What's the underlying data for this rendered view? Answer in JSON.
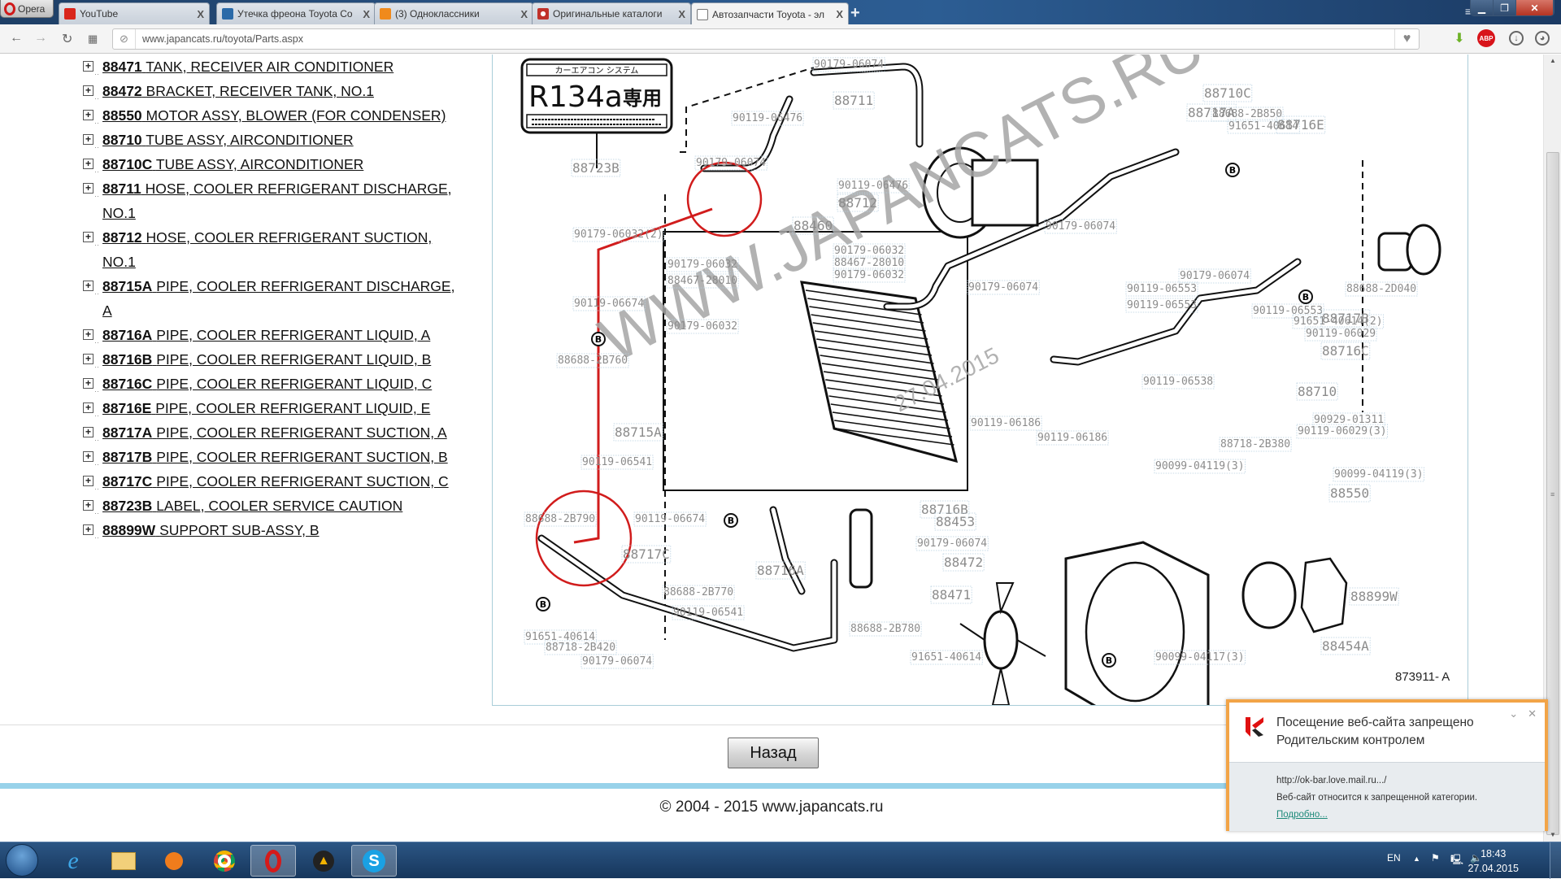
{
  "browser": {
    "menu_label": "Opera",
    "tabs": [
      {
        "label": "YouTube",
        "icon": "youtube-icon",
        "active": false
      },
      {
        "label": "Утечка фреона Toyota Co",
        "icon": "site-v-icon",
        "active": false
      },
      {
        "label": "(3) Одноклассники",
        "icon": "odnoklassniki-icon",
        "active": false
      },
      {
        "label": "Оригинальные каталоги",
        "icon": "catalog-site-icon",
        "active": false
      },
      {
        "label": "Автозапчасти Toyota - эл",
        "icon": "page-icon",
        "active": true
      }
    ],
    "new_tab": "+",
    "close_glyph": "X",
    "url": "www.japancats.ru/toyota/Parts.aspx",
    "extensions": [
      "heart-icon",
      "download-arrow-icon",
      "adblock-icon",
      "downloads-icon",
      "account-icon"
    ],
    "adblock_label": "ABP"
  },
  "parts": [
    {
      "code": "88471",
      "name": "TANK, RECEIVER AIR CONDITIONER"
    },
    {
      "code": "88472",
      "name": "BRACKET, RECEIVER TANK, NO.1"
    },
    {
      "code": "88550",
      "name": "MOTOR ASSY, BLOWER (FOR CONDENSER)"
    },
    {
      "code": "88710",
      "name": "TUBE ASSY, AIRCONDITIONER"
    },
    {
      "code": "88710C",
      "name": "TUBE ASSY, AIRCONDITIONER"
    },
    {
      "code": "88711",
      "name": "HOSE, COOLER REFRIGERANT DISCHARGE, NO.1"
    },
    {
      "code": "88712",
      "name": "HOSE, COOLER REFRIGERANT SUCTION, NO.1"
    },
    {
      "code": "88715A",
      "name": "PIPE, COOLER REFRIGERANT DISCHARGE, A"
    },
    {
      "code": "88716A",
      "name": "PIPE, COOLER REFRIGERANT LIQUID, A"
    },
    {
      "code": "88716B",
      "name": "PIPE, COOLER REFRIGERANT LIQUID, B"
    },
    {
      "code": "88716C",
      "name": "PIPE, COOLER REFRIGERANT LIQUID, C"
    },
    {
      "code": "88716E",
      "name": "PIPE, COOLER REFRIGERANT LIQUID, E"
    },
    {
      "code": "88717A",
      "name": "PIPE, COOLER REFRIGERANT SUCTION, A"
    },
    {
      "code": "88717B",
      "name": "PIPE, COOLER REFRIGERANT SUCTION, B"
    },
    {
      "code": "88717C",
      "name": "PIPE, COOLER REFRIGERANT SUCTION, C"
    },
    {
      "code": "88723B",
      "name": "LABEL, COOLER SERVICE CAUTION"
    },
    {
      "code": "88899W",
      "name": "SUPPORT SUB-ASSY, B"
    }
  ],
  "diagram": {
    "label_plate": {
      "header": "カーエアコン システム",
      "refrigerant": "R134a",
      "kanji": "専用"
    },
    "watermark": "WWW.JAPANCATS.RU",
    "watermark_date": "27.04.2015",
    "figure_id": "873911- A",
    "callouts": [
      "90179-06074",
      "88711",
      "90119-06476",
      "90119-06476",
      "88723B",
      "90179-06074",
      "88712",
      "88460",
      "90179-06032(2)",
      "90179-06032",
      "88467-28010",
      "90179-06032",
      "90179-06032",
      "88467-28010",
      "90179-06032",
      "90119-06674",
      "88688-2B760",
      "88715A",
      "90119-06541",
      "88688-2B790",
      "90119-06674",
      "88717C",
      "88716A",
      "88688-2B770",
      "90119-06541",
      "91651-40614",
      "88718-2B420",
      "90179-06074",
      "88710C",
      "88717A",
      "88688-2B850",
      "91651-40614",
      "88716E",
      "90179-06074",
      "90179-06074",
      "90119-06553",
      "90119-06553",
      "88688-2D040",
      "90179-06074",
      "90119-06553",
      "91651-40614(2)",
      "90119-06029",
      "88717B",
      "88716C",
      "90119-06538",
      "88710",
      "90929-01311",
      "90119-06029(3)",
      "88718-2B380",
      "90119-06186",
      "90119-06186",
      "88716B",
      "90179-06074",
      "88472",
      "88471",
      "88453",
      "90099-04119(3)",
      "90099-04119(3)",
      "88550",
      "88899W",
      "88688-2B780",
      "91651-40614",
      "90099-04117(3)",
      "88454A"
    ]
  },
  "back_button": "Назад",
  "footer": "© 2004 - 2015 www.japancats.ru",
  "notification": {
    "title": "Посещение веб-сайта запрещено Родительским контролем",
    "url": "http://ok-bar.love.mail.ru.../",
    "reason": "Веб-сайт относится к запрещенной категории.",
    "more_link": "Подробно..."
  },
  "taskbar": {
    "apps": [
      "windows-start-icon",
      "internet-explorer-icon",
      "file-explorer-icon",
      "media-player-icon",
      "chrome-icon",
      "opera-icon",
      "aimp-icon",
      "skype-icon"
    ],
    "language": "EN",
    "time": "18:43",
    "date": "27.04.2015"
  }
}
